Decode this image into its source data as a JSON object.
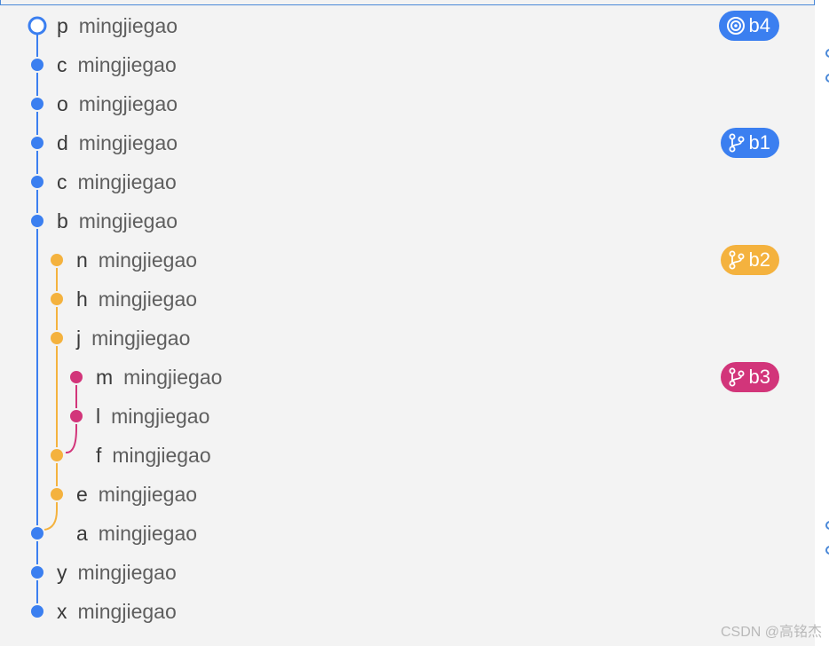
{
  "commits": [
    {
      "subject": "p",
      "author": "mingjiegao",
      "lane": 0,
      "node": "head",
      "color": "#3b7ff0"
    },
    {
      "subject": "c",
      "author": "mingjiegao",
      "lane": 0,
      "node": "dot",
      "color": "#3b7ff0"
    },
    {
      "subject": "o",
      "author": "mingjiegao",
      "lane": 0,
      "node": "dot",
      "color": "#3b7ff0"
    },
    {
      "subject": "d",
      "author": "mingjiegao",
      "lane": 0,
      "node": "dot",
      "color": "#3b7ff0"
    },
    {
      "subject": "c",
      "author": "mingjiegao",
      "lane": 0,
      "node": "dot",
      "color": "#3b7ff0"
    },
    {
      "subject": "b",
      "author": "mingjiegao",
      "lane": 0,
      "node": "dot",
      "color": "#3b7ff0"
    },
    {
      "subject": "n",
      "author": "mingjiegao",
      "lane": 1,
      "node": "dot",
      "color": "#f4b23e"
    },
    {
      "subject": "h",
      "author": "mingjiegao",
      "lane": 1,
      "node": "dot",
      "color": "#f4b23e"
    },
    {
      "subject": "j",
      "author": "mingjiegao",
      "lane": 1,
      "node": "dot",
      "color": "#f4b23e"
    },
    {
      "subject": "m",
      "author": "mingjiegao",
      "lane": 2,
      "node": "dot",
      "color": "#d2357a"
    },
    {
      "subject": "l",
      "author": "mingjiegao",
      "lane": 2,
      "node": "dot",
      "color": "#d2357a"
    },
    {
      "subject": "f",
      "author": "mingjiegao",
      "lane": 1,
      "node": "dot",
      "color": "#f4b23e",
      "text_lane": 2
    },
    {
      "subject": "e",
      "author": "mingjiegao",
      "lane": 1,
      "node": "dot",
      "color": "#f4b23e"
    },
    {
      "subject": "a",
      "author": "mingjiegao",
      "lane": 0,
      "node": "dot",
      "color": "#3b7ff0",
      "text_lane": 1
    },
    {
      "subject": "y",
      "author": "mingjiegao",
      "lane": 0,
      "node": "dot",
      "color": "#3b7ff0"
    },
    {
      "subject": "x",
      "author": "mingjiegao",
      "lane": 0,
      "node": "dot",
      "color": "#3b7ff0"
    }
  ],
  "branches": [
    {
      "label": "b4",
      "row": 0,
      "icon": "target-icon",
      "color": "#3b7ff0"
    },
    {
      "label": "b1",
      "row": 3,
      "icon": "branch-icon",
      "color": "#3b7ff0"
    },
    {
      "label": "b2",
      "row": 6,
      "icon": "branch-icon",
      "color": "#f4b23e"
    },
    {
      "label": "b3",
      "row": 9,
      "icon": "branch-icon",
      "color": "#d2357a"
    }
  ],
  "watermark": "CSDN @高铭杰"
}
